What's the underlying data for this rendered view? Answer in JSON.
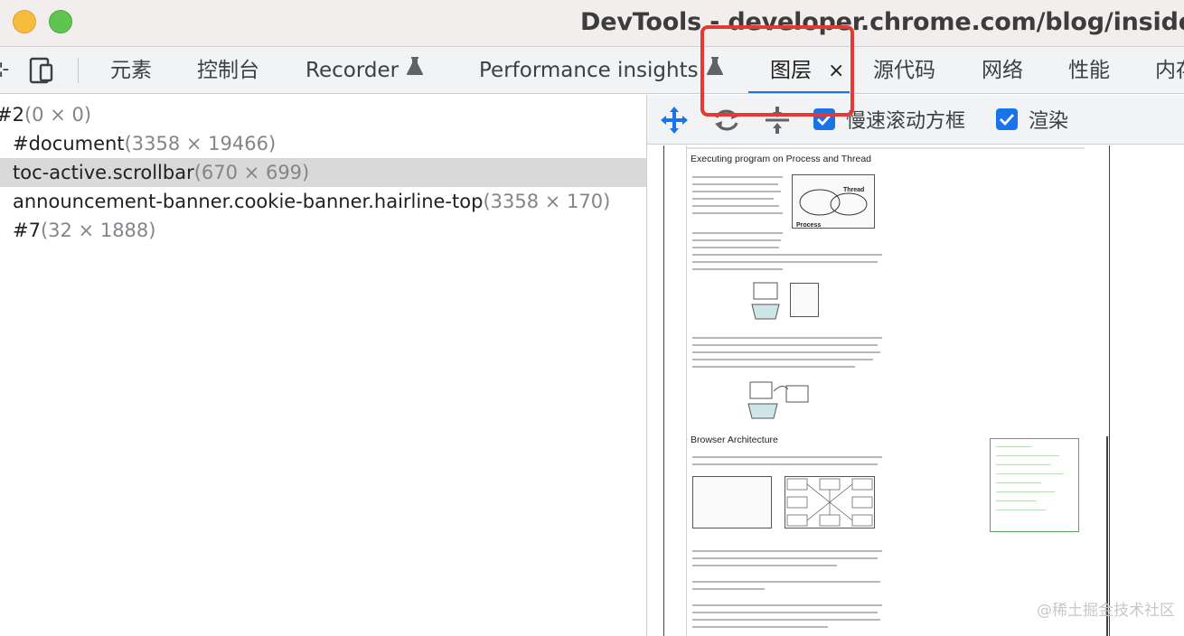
{
  "window": {
    "title": "DevTools - developer.chrome.com/blog/inside-brow"
  },
  "tabs": [
    {
      "label": "元素"
    },
    {
      "label": "控制台"
    },
    {
      "label": "Recorder"
    },
    {
      "label": "Performance insights"
    },
    {
      "label": "图层",
      "active": true,
      "close": "×"
    },
    {
      "label": "源代码"
    },
    {
      "label": "网络"
    },
    {
      "label": "性能"
    },
    {
      "label": "内存"
    }
  ],
  "layers": {
    "rows": [
      {
        "name": "#2",
        "size": "(0 × 0)"
      },
      {
        "name": "#document",
        "size": "(3358 × 19466)"
      },
      {
        "name": "toc-active.scrollbar",
        "size": "(670 × 699)",
        "selected": true
      },
      {
        "name": "announcement-banner.cookie-banner.hairline-top",
        "size": "(3358 × 170)"
      },
      {
        "name": "#7",
        "size": "(32 × 1888)"
      }
    ]
  },
  "toolbar": {
    "slow_scroll_label": "慢速滚动方框",
    "paint_label": "渲染",
    "accent": "#1a73e8"
  },
  "preview": {
    "heading_1": "Executing program on Process and Thread",
    "heading_2": "Browser Architecture",
    "fig1_label_thread": "Thread",
    "fig1_label_process": "Process"
  },
  "watermark": "@稀土掘金技术社区"
}
